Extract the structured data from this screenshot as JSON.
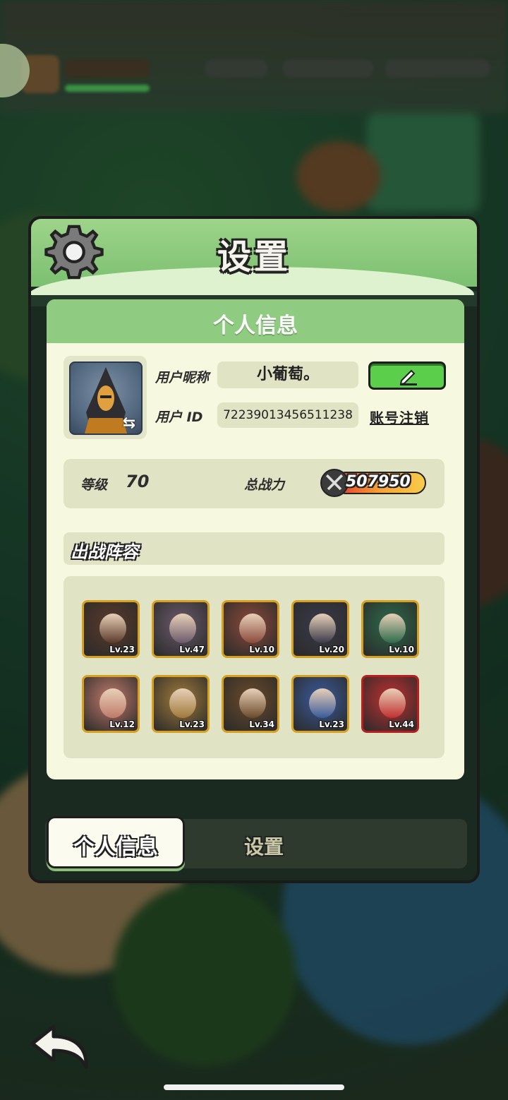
{
  "dialog": {
    "title": "设置",
    "section_title": "个人信息"
  },
  "profile": {
    "nickname_label": "用户昵称",
    "nickname": "小葡萄。",
    "id_label": "用户 ID",
    "user_id": "72239013456511238",
    "deregister_label": "账号注销"
  },
  "stats": {
    "level_label": "等级",
    "level": "70",
    "power_label": "总战力",
    "power": "507950"
  },
  "lineup": {
    "title": "出战阵容",
    "heroes": [
      {
        "level": "Lv.23",
        "color": "#5a3a2a"
      },
      {
        "level": "Lv.47",
        "color": "#6a5a6a"
      },
      {
        "level": "Lv.10",
        "color": "#8a4a3a"
      },
      {
        "level": "Lv.20",
        "color": "#3a3a4a"
      },
      {
        "level": "Lv.10",
        "color": "#2d6a4a"
      },
      {
        "level": "Lv.12",
        "color": "#c07a6a"
      },
      {
        "level": "Lv.23",
        "color": "#a07a3a"
      },
      {
        "level": "Lv.34",
        "color": "#6a4a2a"
      },
      {
        "level": "Lv.23",
        "color": "#3a5a9a"
      },
      {
        "level": "Lv.44",
        "color": "#c03030"
      }
    ]
  },
  "tabs": {
    "active": "个人信息",
    "inactive": "设置"
  },
  "colors": {
    "accent_green": "#8fcb80",
    "edit_button": "#5bcf4b",
    "panel_bg": "#f6f8e0"
  }
}
